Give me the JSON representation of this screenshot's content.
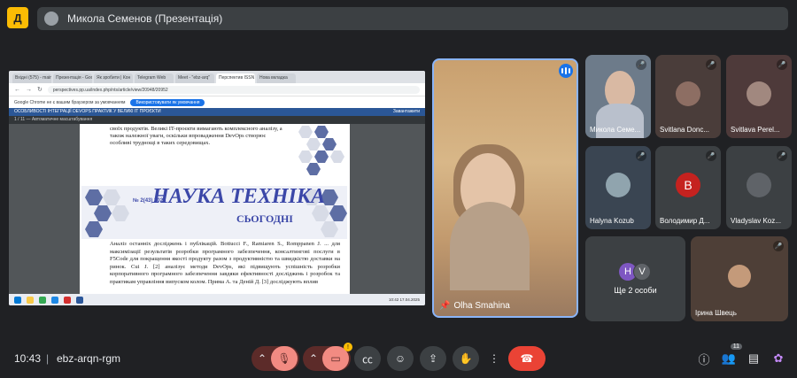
{
  "topbar": {
    "logo_letter": "Д",
    "presenter_label": "Микола Семенов (Презентація)"
  },
  "shared_screen": {
    "tabs": [
      "Вхідні (575) - main",
      "Презентація - Google",
      "Як зробити | Кон",
      "Telegram Web",
      "Meet - \"ebz-arq\"",
      "Перспектив ISSN",
      "Нова вкладка"
    ],
    "url": "perspectives.pp.ua/index.php/nts/article/view/20948/20952",
    "info_text": "Google Chrome не є вашим браузером за умовчанням",
    "info_button": "Використовувати як умовчання",
    "page_header": "ОСОБЛИВОСТІ ІНТЕГРАЦІЇ DEVOPS ПРАКТИК У ВЕЛИКІ ІТ ПРОЄКТИ",
    "page_header_right": "Завантажити",
    "pdf_toolbar": "1 / 11  —  Автоматичне масштабування",
    "top_text": "своїх продуктів. Великі IT-проєкти вимагають комплексного аналізу, а також належної уваги, оскільки впровадження DevOps створює особливі труднощі в таких середовищах.",
    "journal_logo": "НАУКА ТЕХНІКА",
    "journal_sub": "СЬОГОДНІ",
    "journal_issue": "№ 2(43) 2025",
    "body_text": "Аналіз останніх досліджень і публікацій. Bottucci F., Ramiaren S., Romppanen J. ... для максимізації результатів розробки програмного забезпечення, консалтингові послуги в F5Code для покращення якості продукту разом з продуктивністю та швидкістю доставки на ринок. Cui J. [2] аналізує методи DevOps, які підвищують успішність розробки корпоративного програмного забезпечення завдяки ефективності досліджень і розробок та практикам управління випуском колом. Прима А. та Деній Д. [3] досліджують вплив",
    "cookie_text": "Сайт використовує файли cookie для покращення послуг",
    "cookie_button": "Закрити доступ",
    "taskbar_time": "10:42",
    "taskbar_date": "17.04.2025"
  },
  "main_speaker": {
    "name": "Olha Smahina"
  },
  "participants": [
    {
      "name": "Микола Семе...",
      "type": "video"
    },
    {
      "name": "Svitlana Donc...",
      "type": "avatar-photo"
    },
    {
      "name": "Svitlava Perel...",
      "type": "avatar-photo"
    },
    {
      "name": "Halyna Kozub",
      "type": "avatar-photo"
    },
    {
      "name": "Володимир Д...",
      "type": "letter",
      "letter": "В"
    },
    {
      "name": "Vladyslav Koz...",
      "type": "avatar-photo"
    }
  ],
  "more": {
    "label": "Ще 2 особи",
    "letters": [
      "H",
      "V"
    ]
  },
  "big_tile": {
    "name": "Ірина Швець"
  },
  "bottom": {
    "time": "10:43",
    "separator": "|",
    "meeting_code": "ebz-arqn-rgm",
    "participants_count": "11"
  },
  "colors": {
    "accent": "#8ab4f8",
    "hangup": "#ea4335",
    "mic_off": "#f28b82"
  }
}
